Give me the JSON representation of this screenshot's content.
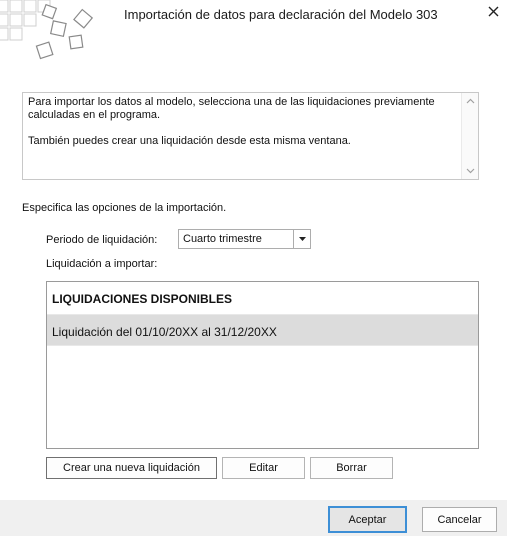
{
  "dialog": {
    "title": "Importación de datos para declaración del Modelo 303"
  },
  "description": {
    "line1": "Para importar los datos al modelo, selecciona una de las liquidaciones previamente calculadas en el programa.",
    "line2": "También puedes crear una liquidación desde esta misma ventana."
  },
  "options": {
    "label": "Especifica las opciones de la importación.",
    "period_label": "Periodo de liquidación:",
    "period_value": "Cuarto trimestre",
    "import_label": "Liquidación a importar:"
  },
  "list": {
    "header": "LIQUIDACIONES DISPONIBLES",
    "items": [
      "Liquidación del 01/10/20XX al 31/12/20XX"
    ],
    "selected_index": 0
  },
  "buttons": {
    "new": "Crear una nueva liquidación",
    "edit": "Editar",
    "delete": "Borrar",
    "accept": "Aceptar",
    "cancel": "Cancelar"
  },
  "icons": {
    "logo": "squares-logo-icon",
    "close": "close-icon",
    "scroll_up": "chevron-up-icon",
    "scroll_down": "chevron-down-icon",
    "dropdown": "dropdown-arrow-icon"
  },
  "colors": {
    "selected_row": "#dcdcdc",
    "default_button_border": "#3d8fd6",
    "footer": "#f0f0f0"
  }
}
